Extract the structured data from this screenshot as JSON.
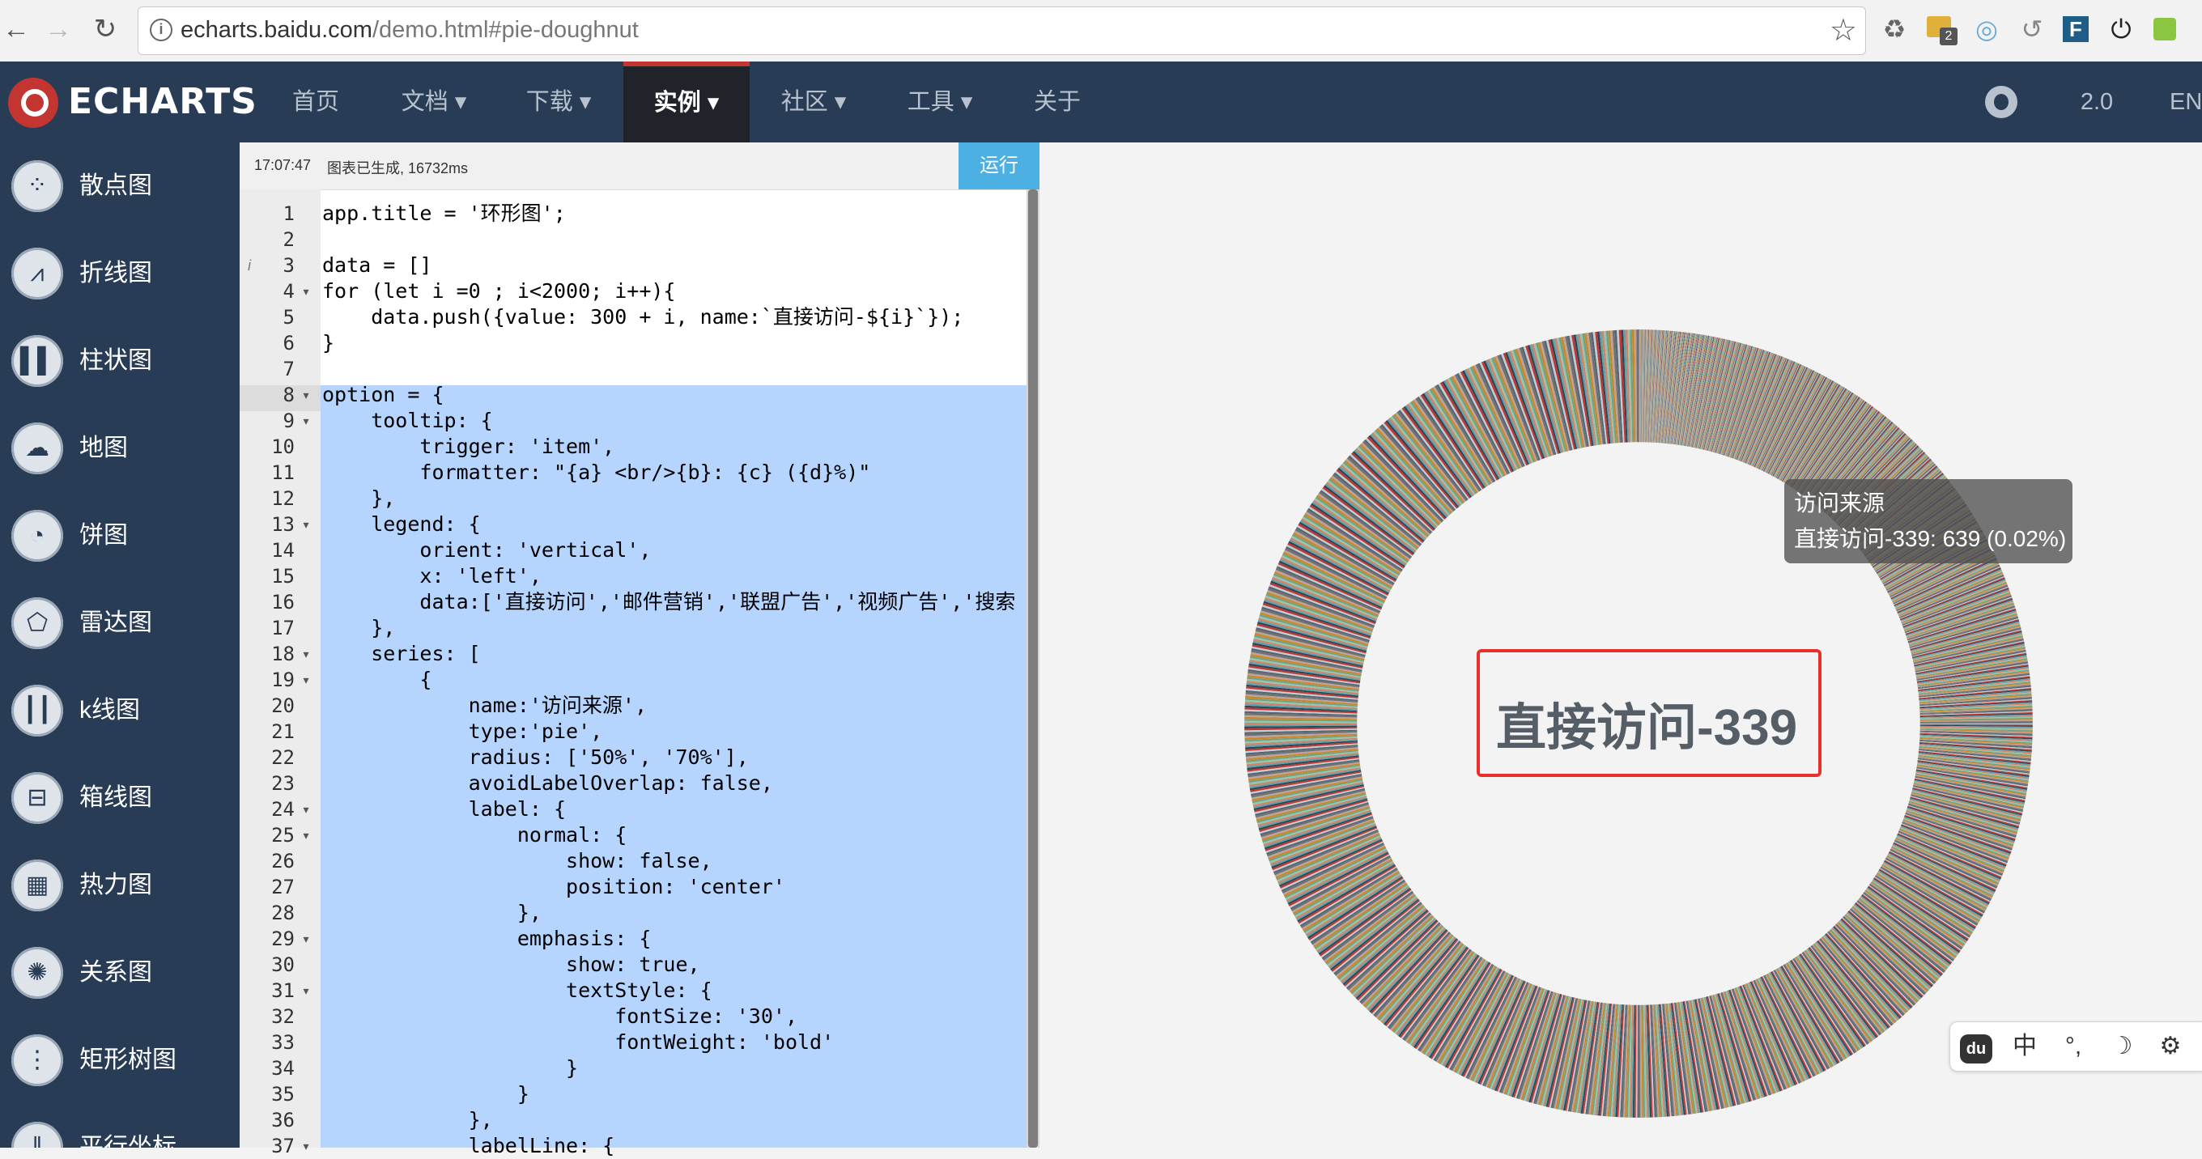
{
  "browser": {
    "url_host": "echarts.baidu.com",
    "url_path": "/demo.html#pie-doughnut",
    "ext_badge": "2"
  },
  "nav": {
    "logo_text": "ECHARTS",
    "items": [
      {
        "label": "首页"
      },
      {
        "label": "文档 ▾"
      },
      {
        "label": "下载 ▾"
      },
      {
        "label": "实例 ▾"
      },
      {
        "label": "社区 ▾"
      },
      {
        "label": "工具 ▾"
      },
      {
        "label": "关于"
      }
    ],
    "version": "2.0",
    "lang": "EN"
  },
  "sidebar": {
    "items": [
      {
        "label": "散点图",
        "icon": "scatter-icon"
      },
      {
        "label": "折线图",
        "icon": "line-chart-icon"
      },
      {
        "label": "柱状图",
        "icon": "bar-chart-icon"
      },
      {
        "label": "地图",
        "icon": "map-icon"
      },
      {
        "label": "饼图",
        "icon": "pie-chart-icon"
      },
      {
        "label": "雷达图",
        "icon": "radar-icon"
      },
      {
        "label": "k线图",
        "icon": "candlestick-icon"
      },
      {
        "label": "箱线图",
        "icon": "boxplot-icon"
      },
      {
        "label": "热力图",
        "icon": "heatmap-icon"
      },
      {
        "label": "关系图",
        "icon": "graph-icon"
      },
      {
        "label": "矩形树图",
        "icon": "treemap-icon"
      },
      {
        "label": "平行坐标",
        "icon": "parallel-icon"
      }
    ]
  },
  "editor": {
    "time": "17:07:47",
    "status": "图表已生成, 16732ms",
    "run_label": "运行",
    "lines": [
      {
        "n": "1",
        "text": "app.title = '环形图';",
        "fold": ""
      },
      {
        "n": "2",
        "text": "",
        "fold": ""
      },
      {
        "n": "3",
        "text": "data = []",
        "fold": ""
      },
      {
        "n": "4",
        "text": "for (let i =0 ; i<2000; i++){",
        "fold": "▾"
      },
      {
        "n": "5",
        "text": "    data.push({value: 300 + i, name:`直接访问-${i}`});",
        "fold": ""
      },
      {
        "n": "6",
        "text": "}",
        "fold": ""
      },
      {
        "n": "7",
        "text": "",
        "fold": ""
      },
      {
        "n": "8",
        "text": "option = {",
        "fold": "▾"
      },
      {
        "n": "9",
        "text": "    tooltip: {",
        "fold": "▾"
      },
      {
        "n": "10",
        "text": "        trigger: 'item',",
        "fold": ""
      },
      {
        "n": "11",
        "text": "        formatter: \"{a} <br/>{b}: {c} ({d}%)\"",
        "fold": ""
      },
      {
        "n": "12",
        "text": "    },",
        "fold": ""
      },
      {
        "n": "13",
        "text": "    legend: {",
        "fold": "▾"
      },
      {
        "n": "14",
        "text": "        orient: 'vertical',",
        "fold": ""
      },
      {
        "n": "15",
        "text": "        x: 'left',",
        "fold": ""
      },
      {
        "n": "16",
        "text": "        data:['直接访问','邮件营销','联盟广告','视频广告','搜索",
        "fold": ""
      },
      {
        "n": "17",
        "text": "    },",
        "fold": ""
      },
      {
        "n": "18",
        "text": "    series: [",
        "fold": "▾"
      },
      {
        "n": "19",
        "text": "        {",
        "fold": "▾"
      },
      {
        "n": "20",
        "text": "            name:'访问来源',",
        "fold": ""
      },
      {
        "n": "21",
        "text": "            type:'pie',",
        "fold": ""
      },
      {
        "n": "22",
        "text": "            radius: ['50%', '70%'],",
        "fold": ""
      },
      {
        "n": "23",
        "text": "            avoidLabelOverlap: false,",
        "fold": ""
      },
      {
        "n": "24",
        "text": "            label: {",
        "fold": "▾"
      },
      {
        "n": "25",
        "text": "                normal: {",
        "fold": "▾"
      },
      {
        "n": "26",
        "text": "                    show: false,",
        "fold": ""
      },
      {
        "n": "27",
        "text": "                    position: 'center'",
        "fold": ""
      },
      {
        "n": "28",
        "text": "                },",
        "fold": ""
      },
      {
        "n": "29",
        "text": "                emphasis: {",
        "fold": "▾"
      },
      {
        "n": "30",
        "text": "                    show: true,",
        "fold": ""
      },
      {
        "n": "31",
        "text": "                    textStyle: {",
        "fold": "▾"
      },
      {
        "n": "32",
        "text": "                        fontSize: '30',",
        "fold": ""
      },
      {
        "n": "33",
        "text": "                        fontWeight: 'bold'",
        "fold": ""
      },
      {
        "n": "34",
        "text": "                    }",
        "fold": ""
      },
      {
        "n": "35",
        "text": "                }",
        "fold": ""
      },
      {
        "n": "36",
        "text": "            },",
        "fold": ""
      },
      {
        "n": "37",
        "text": "            labelLine: {",
        "fold": "▾"
      }
    ]
  },
  "chart": {
    "tooltip_title": "访问来源",
    "tooltip_body": "直接访问-339: 639 (0.02%)",
    "center_label": "直接访问-339"
  },
  "chart_data": {
    "type": "pie",
    "series": [
      {
        "name": "访问来源",
        "count": 2000,
        "start_value": 300,
        "step": 1
      }
    ],
    "radius_inner_pct": 50,
    "radius_outer_pct": 70,
    "colors": [
      "#c23531",
      "#2f4554",
      "#61a0a8",
      "#d48265",
      "#91c7ae",
      "#749f83",
      "#ca8622",
      "#bda29a",
      "#6e7074",
      "#546570",
      "#c4ccd3"
    ]
  },
  "ime": {
    "items": [
      {
        "label": "du",
        "icon": "baidu-paw-icon"
      },
      {
        "label": "中",
        "icon": ""
      },
      {
        "label": "°,",
        "icon": ""
      },
      {
        "label": "☽",
        "icon": "moon-icon"
      },
      {
        "label": "⚙",
        "icon": "gear-icon"
      }
    ]
  },
  "colors": {
    "nav_bg": "#293c55",
    "accent": "#c23531",
    "run_button": "#4cb0e3",
    "selection": "#b5d5ff",
    "highlight_box": "#e8302b"
  }
}
